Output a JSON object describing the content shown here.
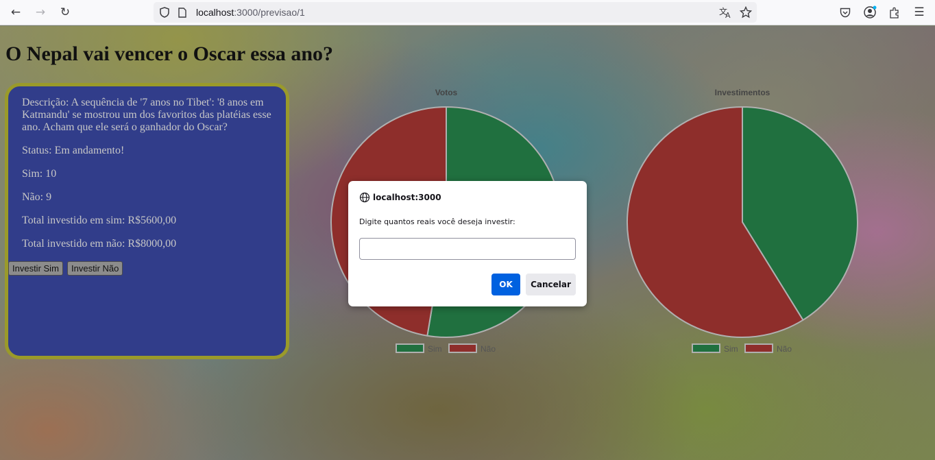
{
  "browser": {
    "url_host": "localhost",
    "url_path": ":3000/previsao/1",
    "icons": {
      "back": "back-arrow-icon",
      "forward": "forward-arrow-icon",
      "reload": "reload-icon",
      "shield": "tracking-shield-icon",
      "page": "page-info-icon",
      "translate": "translate-icon",
      "bookmark": "bookmark-star-icon",
      "pocket": "pocket-icon",
      "account": "account-icon",
      "extensions": "extensions-icon",
      "menu": "hamburger-menu-icon"
    }
  },
  "page": {
    "title": "O Nepal vai vencer o Oscar essa ano?"
  },
  "card": {
    "description": "Descrição: A sequência de '7 anos no Tibet': '8 anos em Katmandu' se mostrou um dos favoritos das platéias esse ano. Acham que ele será o ganhador do Oscar?",
    "status": "Status: Em andamento!",
    "sim": "Sim: 10",
    "nao": "Não: 9",
    "total_sim": "Total investido em sim: R$5600,00",
    "total_nao": "Total investido em não: R$8000,00",
    "btn_sim": "Investir Sim",
    "btn_nao": "Investir Não"
  },
  "colors": {
    "sim": "#20703f",
    "nao": "#8e2e2b",
    "card_bg": "#313d8a",
    "card_border": "#9a9a2a"
  },
  "chart_data": [
    {
      "type": "pie",
      "title": "Votos",
      "categories": [
        "Sim",
        "Não"
      ],
      "values": [
        10,
        9
      ],
      "legend": "bottom"
    },
    {
      "type": "pie",
      "title": "Investimentos",
      "categories": [
        "Sim",
        "Não"
      ],
      "values": [
        5600,
        8000
      ],
      "legend": "bottom"
    }
  ],
  "dialog": {
    "origin": "localhost:3000",
    "message": "Digite quantos reais você deseja investir:",
    "input_value": "",
    "ok_label": "OK",
    "cancel_label": "Cancelar"
  }
}
